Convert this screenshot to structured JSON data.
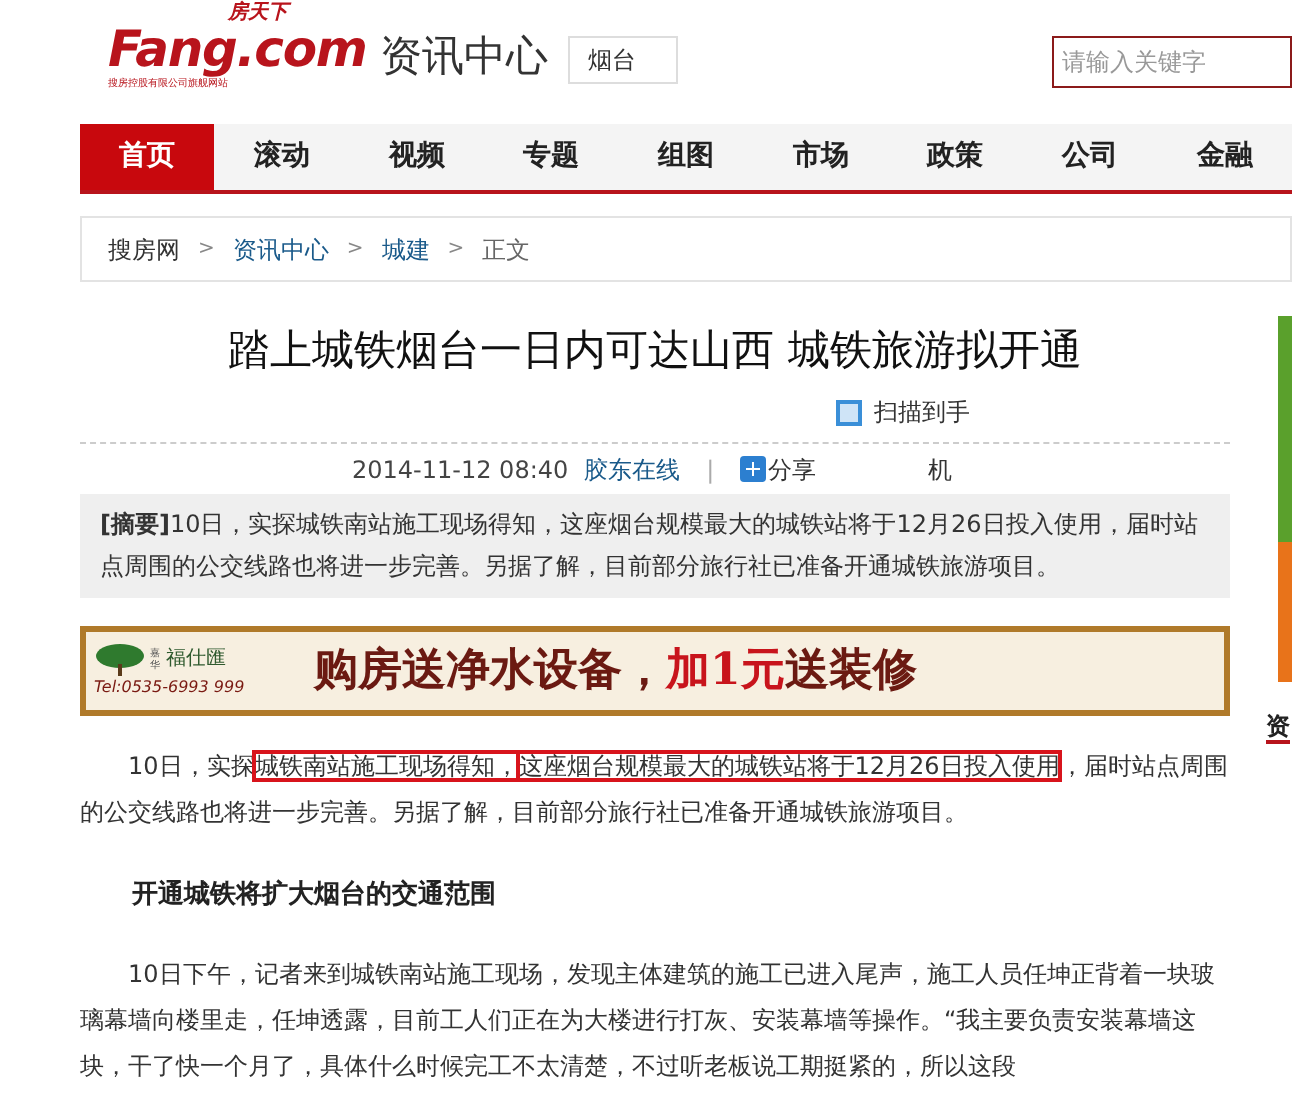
{
  "header": {
    "logo_top": "房天下",
    "logo": "Fang.com",
    "logo_tagline": "搜房控股有限公司旗舰网站",
    "section_title": "资讯中心",
    "city": "烟台",
    "search": {
      "placeholder": "请输入关键字"
    }
  },
  "nav": [
    {
      "label": "首页",
      "selected": true
    },
    {
      "label": "滚动",
      "selected": false
    },
    {
      "label": "视频",
      "selected": false
    },
    {
      "label": "专题",
      "selected": false
    },
    {
      "label": "组图",
      "selected": false
    },
    {
      "label": "市场",
      "selected": false
    },
    {
      "label": "政策",
      "selected": false
    },
    {
      "label": "公司",
      "selected": false
    },
    {
      "label": "金融",
      "selected": false
    }
  ],
  "breadcrumb": [
    {
      "label": "搜房网",
      "kind": "plain"
    },
    {
      "label": "资讯中心",
      "kind": "link"
    },
    {
      "label": "城建",
      "kind": "link"
    },
    {
      "label": "正文",
      "kind": "current"
    }
  ],
  "breadcrumb_separator": ">",
  "article": {
    "title": "踏上城铁烟台一日内可达山西 城铁旅游拟开通",
    "scan": "扫描到手",
    "date": "2014-11-12 08:40",
    "source": "胶东在线",
    "meta_separator": "|",
    "share": "分享",
    "share_tail": "机",
    "summary": "**[摘要]**10日，实探城铁南站施工现场得知，这座烟台规模最大的城铁站将于12月26日投入使用，届时站点周围的公交线路也将进一步完善。另据了解，目前部分旅行社已准备开通城铁旅游项目。",
    "ad": {
      "brand_mark": "嘉华",
      "brand": "福仕匯",
      "phone": "Tel:0535-6993 999",
      "slogan": [
        {
          "text": "购房送净水设备，",
          "color": "#6b1a12"
        },
        {
          "text": "加1元",
          "color": "#c8141c"
        },
        {
          "text": "送装修",
          "color": "#6b1a12"
        }
      ]
    },
    "paragraph_1": [
      {
        "text": "10日，实探",
        "highlighted": false
      },
      {
        "text": "城铁南站施工现场得知，",
        "highlighted": true
      },
      {
        "text": "这座烟台规模最大的城铁站将于12月26日投入使用",
        "highlighted": true
      },
      {
        "text": "，届时站点周围的公交线路也将进一步完善。另据了解，目前部分旅行社已准备开通城铁旅游项目。",
        "highlighted": false
      }
    ],
    "subheading": "开通城铁将扩大烟台的交通范围",
    "paragraph_2": "10日下午，记者来到城铁南站施工现场，发现主体建筑的施工已进入尾声，施工人员任坤正背着一块玻璃幕墙向楼里走，任坤透露，目前工人们正在为大楼进行打灰、安装幕墙等操作。“我主要负责安装幕墙这块，干了快一个月了，具体什么时候完工不太清楚，不过听老板说工期挺紧的，所以这段"
  },
  "side": {
    "heading": "资"
  }
}
